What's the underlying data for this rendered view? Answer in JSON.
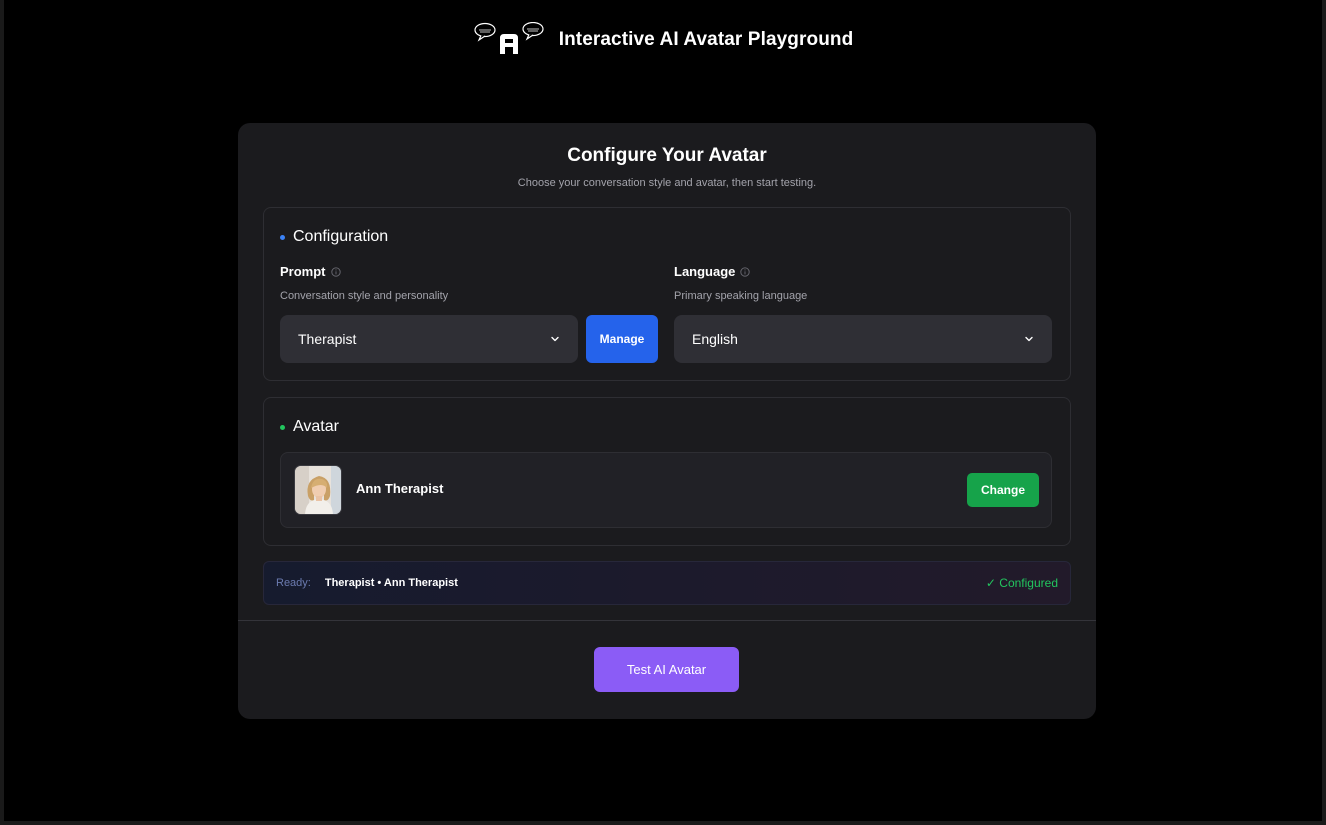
{
  "header": {
    "logo_icon": "speech-bubbles-logo-icon",
    "title": "Interactive AI Avatar Playground"
  },
  "card": {
    "title": "Configure Your Avatar",
    "subtitle": "Choose your conversation style and avatar, then start testing."
  },
  "configuration": {
    "heading": "Configuration",
    "dot_color": "#3b82f6",
    "prompt": {
      "label": "Prompt",
      "description": "Conversation style and personality",
      "selected": "Therapist",
      "manage_label": "Manage"
    },
    "language": {
      "label": "Language",
      "description": "Primary speaking language",
      "selected": "English"
    }
  },
  "avatar": {
    "heading": "Avatar",
    "dot_color": "#22c55e",
    "name": "Ann Therapist",
    "change_label": "Change"
  },
  "status": {
    "ready_label": "Ready:",
    "summary": "Therapist • Ann Therapist",
    "configured": "✓ Configured"
  },
  "actions": {
    "test_label": "Test AI Avatar"
  },
  "colors": {
    "accent_blue": "#2563eb",
    "accent_green": "#16a34a",
    "accent_purple": "#8b5cf6"
  }
}
